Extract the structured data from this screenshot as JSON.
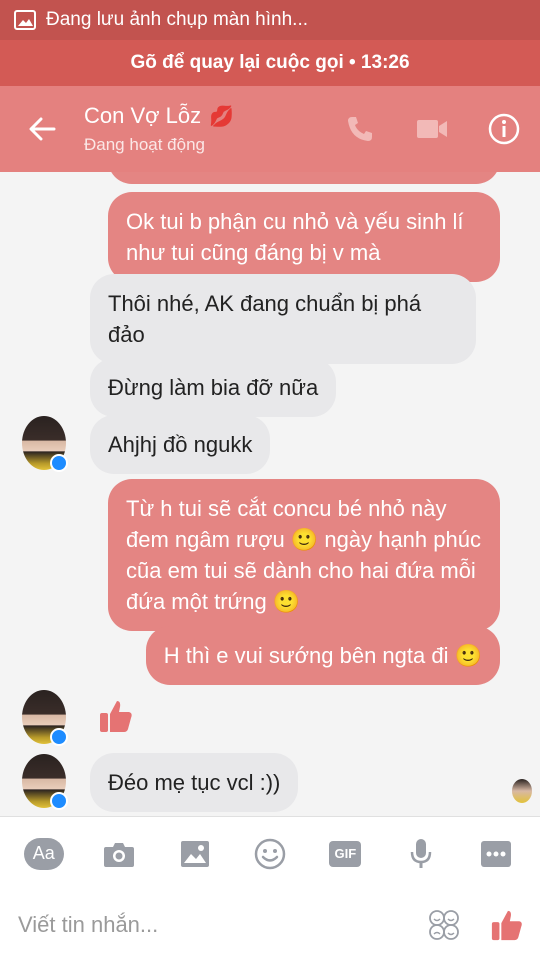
{
  "status_bar": {
    "text": "Đang lưu ảnh chụp màn hình..."
  },
  "call_banner": {
    "text": "Gõ để quay lại cuộc gọi • 13:26"
  },
  "header": {
    "name": "Con Vợ Lỗz",
    "status": "Đang hoạt động",
    "name_emoji": "💋"
  },
  "messages": [
    {
      "dir": "out",
      "text": "Ok tui b phận cu nhỏ và yếu sinh lí như tui cũng đáng bị v mà"
    },
    {
      "dir": "in",
      "text": "Thôi nhé, AK đang chuẩn bị phá đảo"
    },
    {
      "dir": "in",
      "text": "Đừng làm bia đỡ nữa"
    },
    {
      "dir": "in",
      "text": "Ahjhj đồ ngukk"
    },
    {
      "dir": "out",
      "text": "Từ h tui sẽ cắt concu bé nhỏ này đem ngâm rượu 🙂 ngày hạnh phúc cũa em tui sẽ dành cho hai đứa mỗi đứa một trứng 🙂"
    },
    {
      "dir": "out",
      "text": "H thì e vui sướng bên ngta đi 🙂"
    },
    {
      "dir": "in",
      "text": "Đéo mẹ tục vcl :))"
    }
  ],
  "toolbar": {
    "aa_label": "Aa",
    "gif_label": "GIF"
  },
  "input": {
    "placeholder": "Viết tin nhắn..."
  },
  "icons": [
    "image-icon",
    "back-arrow-icon",
    "phone-icon",
    "video-camera-icon",
    "info-icon",
    "thumbs-up-icon",
    "camera-icon",
    "gallery-icon",
    "emoji-icon",
    "microphone-icon",
    "more-icon",
    "sticker-icon"
  ],
  "colors": {
    "status_bar": "#c2534f",
    "call_banner": "#d35a55",
    "header": "#e4817f",
    "outgoing_bubble": "#e48583",
    "incoming_bubble": "#e8e8ea",
    "like": "#e57373"
  }
}
